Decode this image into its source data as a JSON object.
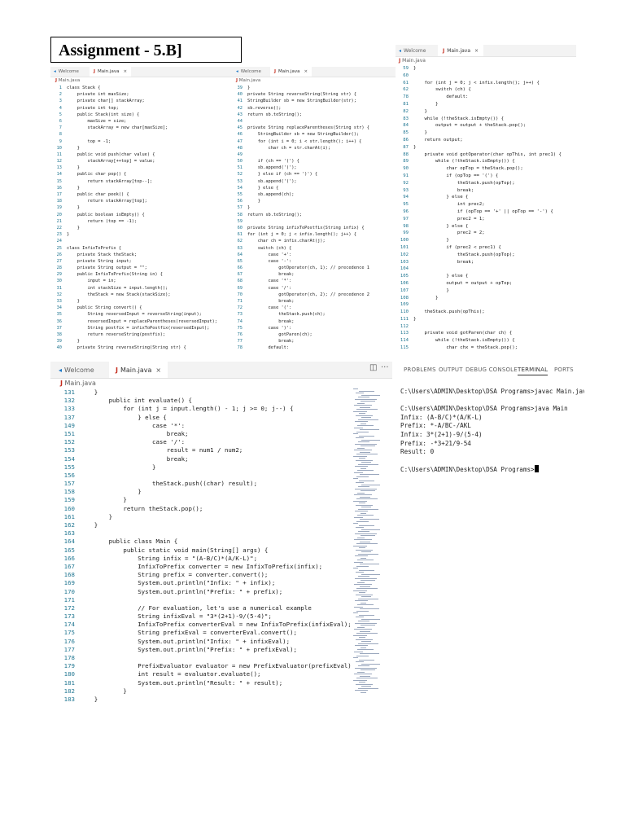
{
  "title": "Assignment - 5.B]",
  "panel1": {
    "tabs": [
      {
        "label": "Welcome",
        "icon": "vscode-icon"
      },
      {
        "label": "Main.java",
        "icon": "java-icon",
        "close": "×"
      }
    ],
    "breadcrumb": "Main.java",
    "lines": [
      {
        "n": "1",
        "t": "class Stack {"
      },
      {
        "n": "2",
        "t": "    private int maxSize;"
      },
      {
        "n": "3",
        "t": "    private char[] stackArray;"
      },
      {
        "n": "4",
        "t": "    private int top;"
      },
      {
        "n": "5",
        "t": "    public Stack(int size) {"
      },
      {
        "n": "6",
        "t": "        maxSize = size;"
      },
      {
        "n": "7",
        "t": "        stackArray = new char[maxSize];"
      },
      {
        "n": "8",
        "t": ""
      },
      {
        "n": "9",
        "t": "        top = -1;"
      },
      {
        "n": "10",
        "t": "    }"
      },
      {
        "n": "11",
        "t": "    public void push(char value) {"
      },
      {
        "n": "12",
        "t": "        stackArray[++top] = value;"
      },
      {
        "n": "13",
        "t": "    }"
      },
      {
        "n": "14",
        "t": "    public char pop() {"
      },
      {
        "n": "15",
        "t": "        return stackArray[top--];"
      },
      {
        "n": "16",
        "t": "    }"
      },
      {
        "n": "17",
        "t": "    public char peek() {"
      },
      {
        "n": "18",
        "t": "        return stackArray[top];"
      },
      {
        "n": "19",
        "t": "    }"
      },
      {
        "n": "20",
        "t": "    public boolean isEmpty() {"
      },
      {
        "n": "21",
        "t": "        return (top == -1);"
      },
      {
        "n": "22",
        "t": "    }"
      },
      {
        "n": "23",
        "t": "}"
      },
      {
        "n": "24",
        "t": ""
      },
      {
        "n": "25",
        "t": "class InfixToPrefix {"
      },
      {
        "n": "26",
        "t": "    private Stack theStack;"
      },
      {
        "n": "27",
        "t": "    private String input;"
      },
      {
        "n": "28",
        "t": "    private String output = \"\";"
      },
      {
        "n": "29",
        "t": "    public InfixToPrefix(String in) {"
      },
      {
        "n": "30",
        "t": "        input = in;"
      },
      {
        "n": "31",
        "t": "        int stackSize = input.length();"
      },
      {
        "n": "32",
        "t": "        theStack = new Stack(stackSize);"
      },
      {
        "n": "33",
        "t": "    }"
      },
      {
        "n": "34",
        "t": "    public String convert() {"
      },
      {
        "n": "35",
        "t": "        String reversedInput = reverseString(input);"
      },
      {
        "n": "36",
        "t": "        reversedInput = replaceParentheses(reversedInput);"
      },
      {
        "n": "37",
        "t": "        String postfix = infixToPostfix(reversedInput);"
      },
      {
        "n": "38",
        "t": "        return reverseString(postfix);"
      },
      {
        "n": "39",
        "t": "    }"
      },
      {
        "n": "40",
        "t": "    private String reverseString(String str) {"
      }
    ]
  },
  "panel2": {
    "tabs": [
      {
        "label": "Welcome",
        "icon": "vscode-icon"
      },
      {
        "label": "Main.java",
        "icon": "java-icon",
        "close": "×"
      }
    ],
    "breadcrumb": "Main.java",
    "lines": [
      {
        "n": "39",
        "t": "}"
      },
      {
        "n": "40",
        "t": "private String reverseString(String str) {"
      },
      {
        "n": "41",
        "t": "StringBuilder sb = new StringBuilder(str);"
      },
      {
        "n": "42",
        "t": "sb.reverse();"
      },
      {
        "n": "43",
        "t": "return sb.toString();"
      },
      {
        "n": "44",
        "t": ""
      },
      {
        "n": "45",
        "t": "private String replaceParentheses(String str) {"
      },
      {
        "n": "46",
        "t": "    StringBuilder sb = new StringBuilder();"
      },
      {
        "n": "47",
        "t": "    for (int i = 0; i < str.length(); i++) {"
      },
      {
        "n": "48",
        "t": "        char ch = str.charAt(i);"
      },
      {
        "n": "49",
        "t": ""
      },
      {
        "n": "50",
        "t": "    if (ch == '(') {"
      },
      {
        "n": "51",
        "t": "    sb.append(')');"
      },
      {
        "n": "52",
        "t": "    } else if (ch == ')') {"
      },
      {
        "n": "53",
        "t": "    sb.append('(');"
      },
      {
        "n": "54",
        "t": "    } else {"
      },
      {
        "n": "55",
        "t": "    sb.append(ch);"
      },
      {
        "n": "56",
        "t": "    }"
      },
      {
        "n": "57",
        "t": "}"
      },
      {
        "n": "58",
        "t": "return sb.toString();"
      },
      {
        "n": "59",
        "t": ""
      },
      {
        "n": "60",
        "t": "private String infixToPostfix(String infix) {"
      },
      {
        "n": "61",
        "t": "for (int j = 0; j < infix.length(); j++) {"
      },
      {
        "n": "62",
        "t": "    char ch = infix.charAt(j);"
      },
      {
        "n": "63",
        "t": "    switch (ch) {"
      },
      {
        "n": "64",
        "t": "        case '+':"
      },
      {
        "n": "65",
        "t": "        case '-':"
      },
      {
        "n": "66",
        "t": "            gotOperator(ch, 1); // precedence 1"
      },
      {
        "n": "67",
        "t": "            break;"
      },
      {
        "n": "68",
        "t": "        case '*':"
      },
      {
        "n": "69",
        "t": "        case '/':"
      },
      {
        "n": "70",
        "t": "            gotOperator(ch, 2); // precedence 2"
      },
      {
        "n": "71",
        "t": "            break;"
      },
      {
        "n": "72",
        "t": "        case '(':"
      },
      {
        "n": "73",
        "t": "            theStack.push(ch);"
      },
      {
        "n": "74",
        "t": "            break;"
      },
      {
        "n": "75",
        "t": "        case ')':"
      },
      {
        "n": "76",
        "t": "            gotParen(ch);"
      },
      {
        "n": "77",
        "t": "            break;"
      },
      {
        "n": "78",
        "t": "        default:"
      }
    ]
  },
  "panel3": {
    "tabs": [
      {
        "label": "Welcome",
        "icon": "vscode-icon"
      },
      {
        "label": "Main.java",
        "icon": "java-icon",
        "close": "×"
      }
    ],
    "breadcrumb": "Main.java",
    "lines": [
      {
        "n": "59",
        "t": "}"
      },
      {
        "n": "60",
        "t": ""
      },
      {
        "n": "61",
        "t": "    for (int j = 0; j < infix.length(); j++) {"
      },
      {
        "n": "62",
        "t": "        switch (ch) {"
      },
      {
        "n": "78",
        "t": "            default:"
      },
      {
        "n": "81",
        "t": "        }"
      },
      {
        "n": "82",
        "t": "    }"
      },
      {
        "n": "83",
        "t": "    while (!theStack.isEmpty()) {"
      },
      {
        "n": "84",
        "t": "        output = output + theStack.pop();"
      },
      {
        "n": "85",
        "t": "    }"
      },
      {
        "n": "86",
        "t": "    return output;"
      },
      {
        "n": "87",
        "t": "}"
      },
      {
        "n": "88",
        "t": "    private void gotOperator(char opThis, int prec1) {"
      },
      {
        "n": "89",
        "t": "        while (!theStack.isEmpty()) {"
      },
      {
        "n": "90",
        "t": "            char opTop = theStack.pop();"
      },
      {
        "n": "91",
        "t": "            if (opTop == '(') {"
      },
      {
        "n": "92",
        "t": "                theStack.push(opTop);"
      },
      {
        "n": "93",
        "t": "                break;"
      },
      {
        "n": "94",
        "t": "            } else {"
      },
      {
        "n": "95",
        "t": "                int prec2;"
      },
      {
        "n": "96",
        "t": "                if (opTop == '+' || opTop == '-') {"
      },
      {
        "n": "97",
        "t": "                prec2 = 1;"
      },
      {
        "n": "98",
        "t": "            } else {"
      },
      {
        "n": "99",
        "t": "                prec2 = 2;"
      },
      {
        "n": "100",
        "t": "            }"
      },
      {
        "n": "101",
        "t": "            if (prec2 < prec1) {"
      },
      {
        "n": "102",
        "t": "                theStack.push(opTop);"
      },
      {
        "n": "103",
        "t": "                break;"
      },
      {
        "n": "104",
        "t": ""
      },
      {
        "n": "105",
        "t": "            } else {"
      },
      {
        "n": "106",
        "t": "            output = output + opTop;"
      },
      {
        "n": "107",
        "t": "            }"
      },
      {
        "n": "108",
        "t": "        }"
      },
      {
        "n": "109",
        "t": ""
      },
      {
        "n": "110",
        "t": "    theStack.push(opThis);"
      },
      {
        "n": "111",
        "t": "}"
      },
      {
        "n": "112",
        "t": ""
      },
      {
        "n": "113",
        "t": "    private void gotParen(char ch) {"
      },
      {
        "n": "114",
        "t": "        while (!theStack.isEmpty()) {"
      },
      {
        "n": "115",
        "t": "            char chx = theStack.pop();"
      }
    ]
  },
  "panel4": {
    "tabs": [
      {
        "label": "Welcome",
        "icon": "vscode-icon"
      },
      {
        "label": "Main.java",
        "icon": "java-icon",
        "close": "×"
      }
    ],
    "breadcrumb": "Main.java",
    "toolbar": {
      "split": "◫",
      "more": "···"
    },
    "lines": [
      {
        "n": "131",
        "t": "    }"
      },
      {
        "n": "132",
        "t": "        public int evaluate() {"
      },
      {
        "n": "133",
        "t": "            for (int j = input.length() - 1; j >= 0; j--) {"
      },
      {
        "n": "137",
        "t": "                } else {"
      },
      {
        "n": "149",
        "t": "                    case '*':"
      },
      {
        "n": "151",
        "t": "                        break;"
      },
      {
        "n": "152",
        "t": "                    case '/':"
      },
      {
        "n": "153",
        "t": "                        result = num1 / num2;"
      },
      {
        "n": "154",
        "t": "                        break;"
      },
      {
        "n": "155",
        "t": "                    }"
      },
      {
        "n": "156",
        "t": ""
      },
      {
        "n": "157",
        "t": "                    theStack.push((char) result);"
      },
      {
        "n": "158",
        "t": "                }"
      },
      {
        "n": "159",
        "t": "            }"
      },
      {
        "n": "160",
        "t": "            return theStack.pop();"
      },
      {
        "n": "161",
        "t": "        }"
      },
      {
        "n": "162",
        "t": "    }"
      },
      {
        "n": "163",
        "t": ""
      },
      {
        "n": "164",
        "t": "        public class Main {"
      },
      {
        "n": "165",
        "t": "            public static void main(String[] args) {"
      },
      {
        "n": "166",
        "t": "                String infix = \"(A-B/C)*(A/K-L)\";"
      },
      {
        "n": "167",
        "t": "                InfixToPrefix converter = new InfixToPrefix(infix);"
      },
      {
        "n": "168",
        "t": "                String prefix = converter.convert();"
      },
      {
        "n": "169",
        "t": "                System.out.println(\"Infix: \" + infix);"
      },
      {
        "n": "170",
        "t": "                System.out.println(\"Prefix: \" + prefix);"
      },
      {
        "n": "171",
        "t": ""
      },
      {
        "n": "172",
        "t": "                // For evaluation, let's use a numerical example"
      },
      {
        "n": "173",
        "t": "                String infixEval = \"3*(2+1)-9/(5-4)\";"
      },
      {
        "n": "174",
        "t": "                InfixToPrefix converterEval = new InfixToPrefix(infixEval);"
      },
      {
        "n": "175",
        "t": "                String prefixEval = converterEval.convert();"
      },
      {
        "n": "176",
        "t": "                System.out.println(\"Infix: \" + infixEval);"
      },
      {
        "n": "177",
        "t": "                System.out.println(\"Prefix: \" + prefixEval);"
      },
      {
        "n": "178",
        "t": ""
      },
      {
        "n": "179",
        "t": "                PrefixEvaluator evaluator = new PrefixEvaluator(prefixEval);"
      },
      {
        "n": "180",
        "t": "                int result = evaluator.evaluate();"
      },
      {
        "n": "181",
        "t": "                System.out.println(\"Result: \" + result);"
      },
      {
        "n": "182",
        "t": "            }"
      },
      {
        "n": "183",
        "t": "    }"
      }
    ]
  },
  "terminal": {
    "tabs": [
      "PROBLEMS",
      "OUTPUT",
      "DEBUG CONSOLE",
      "TERMINAL",
      "PORTS"
    ],
    "active_tab": "TERMINAL",
    "lines": [
      "C:\\Users\\ADMIN\\Desktop\\DSA Programs>javac Main.java",
      "",
      "C:\\Users\\ADMIN\\Desktop\\DSA Programs>java Main",
      "Infix: (A-B/C)*(A/K-L)",
      "Prefix: *-A/BC-/AKL",
      "Infix: 3*(2+1)-9/(5-4)",
      "Prefix: -*3+21/9-54",
      "Result: 0",
      "",
      "C:\\Users\\ADMIN\\Desktop\\DSA Programs>"
    ]
  }
}
